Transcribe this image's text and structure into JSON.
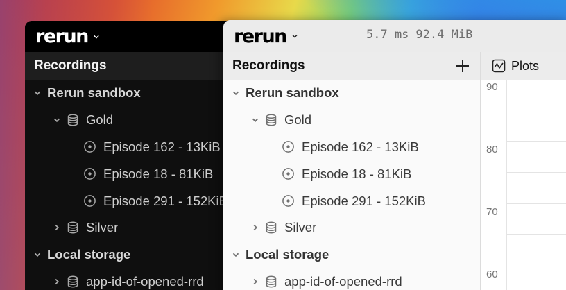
{
  "colors": {
    "dark_bg": "#0f0f0f",
    "dark_header": "#1e1e1e",
    "light_bg": "#f6f6f6",
    "light_header": "#ececec"
  },
  "dark_window": {
    "logo": "rerun",
    "section_title": "Recordings",
    "tree": [
      {
        "label": "Rerun sandbox",
        "type": "group",
        "expanded": true,
        "icon": "chevron-down-icon"
      },
      {
        "label": "Gold",
        "type": "dataset",
        "expanded": true,
        "icon": "database-icon"
      },
      {
        "label": "Episode 162 - 13KiB",
        "type": "recording",
        "icon": "recording-icon"
      },
      {
        "label": "Episode 18 - 81KiB",
        "type": "recording",
        "icon": "recording-icon"
      },
      {
        "label": "Episode 291 - 152KiB",
        "type": "recording",
        "icon": "recording-icon"
      },
      {
        "label": "Silver",
        "type": "dataset",
        "expanded": false,
        "icon": "database-icon"
      },
      {
        "label": "Local storage",
        "type": "group",
        "expanded": true,
        "icon": "chevron-down-icon"
      },
      {
        "label": "app-id-of-opened-rrd",
        "type": "dataset",
        "expanded": false,
        "icon": "database-icon"
      }
    ]
  },
  "light_window": {
    "logo": "rerun",
    "perf": {
      "frame_time": "5.7 ms",
      "memory": "92.4 MiB"
    },
    "section_title": "Recordings",
    "add_button_icon": "plus-icon",
    "tree": [
      {
        "label": "Rerun sandbox",
        "type": "group",
        "expanded": true
      },
      {
        "label": "Gold",
        "type": "dataset",
        "expanded": true
      },
      {
        "label": "Episode 162 - 13KiB",
        "type": "recording"
      },
      {
        "label": "Episode 18 - 81KiB",
        "type": "recording"
      },
      {
        "label": "Episode 291 - 152KiB",
        "type": "recording"
      },
      {
        "label": "Silver",
        "type": "dataset",
        "expanded": false
      },
      {
        "label": "Local storage",
        "type": "group",
        "expanded": true
      },
      {
        "label": "app-id-of-opened-rrd",
        "type": "dataset",
        "expanded": false
      }
    ],
    "plots_tab": {
      "label": "Plots",
      "icon": "timeseries-icon"
    },
    "plot_ticks": [
      "90",
      "80",
      "70",
      "60"
    ]
  }
}
